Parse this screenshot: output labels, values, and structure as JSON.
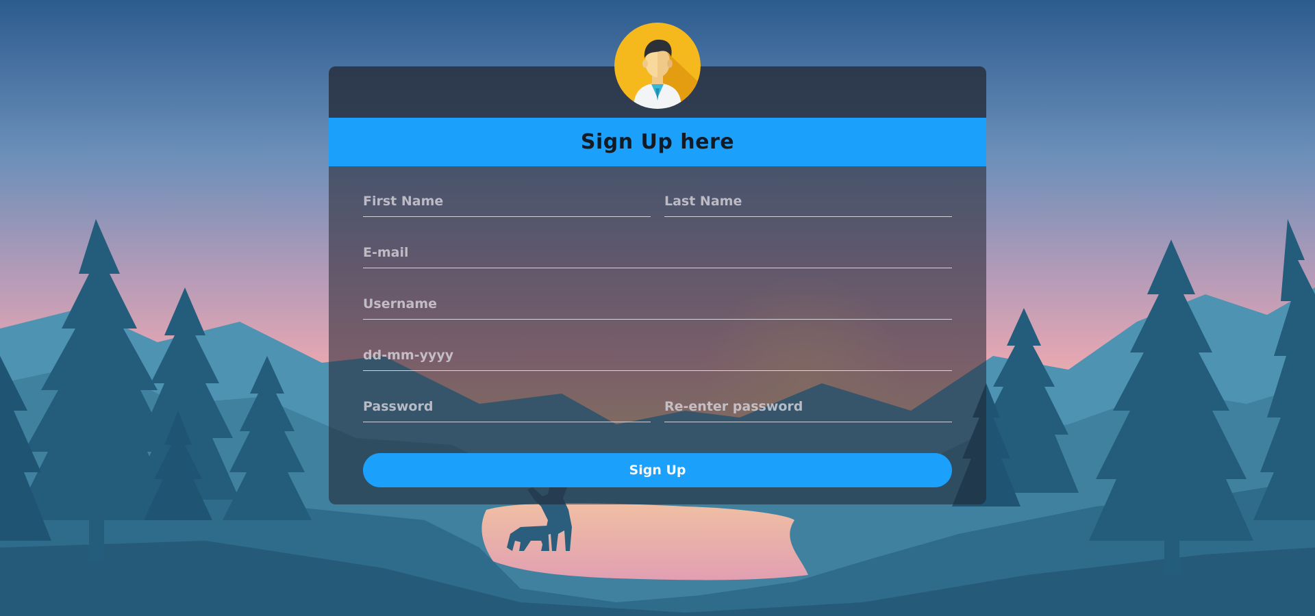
{
  "form": {
    "title": "Sign Up here",
    "fields": {
      "first_name": {
        "placeholder": "First Name",
        "value": ""
      },
      "last_name": {
        "placeholder": "Last Name",
        "value": ""
      },
      "email": {
        "placeholder": "E-mail",
        "value": ""
      },
      "username": {
        "placeholder": "Username",
        "value": ""
      },
      "birthdate": {
        "placeholder": "dd-mm-yyyy",
        "value": ""
      },
      "password": {
        "placeholder": "Password",
        "value": ""
      },
      "confirm_password": {
        "placeholder": "Re-enter password",
        "value": ""
      }
    },
    "submit_label": "Sign Up"
  },
  "colors": {
    "accent": "#1ba1fc",
    "avatar_bg": "#f6b91d",
    "title_text": "#141a22"
  },
  "icons": {
    "avatar": "user-avatar-icon"
  }
}
